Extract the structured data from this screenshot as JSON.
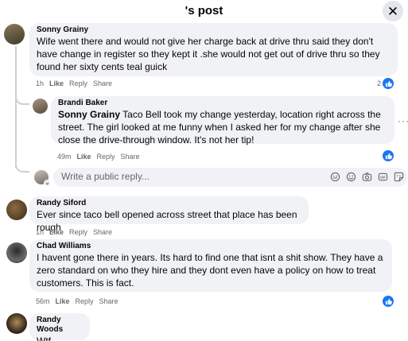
{
  "header": {
    "title": "'s post",
    "close_label": "✕"
  },
  "comments": [
    {
      "name": "Sonny Grainy",
      "text": "Wife went there and would not give her charge back at drive thru said they don't have change in register so they kept it .she would not get out of drive thru so they found her sixty cents teal guick",
      "time": "1h",
      "like": "Like",
      "reply": "Reply",
      "share": "Share",
      "reaction_count": "2"
    },
    {
      "name": "Brandi Baker",
      "mention": "Sonny Grainy",
      "text": " Taco Bell took my change yesterday, location right across the street. The girl looked at me funny when I asked her for my change after she close the drive-through window. It's not her tip!",
      "time": "49m",
      "like": "Like",
      "reply": "Reply",
      "share": "Share"
    },
    {
      "name": "Randy Siford",
      "text": "Ever since taco bell opened across street that place has been rough",
      "time": "1h",
      "like": "Like",
      "reply": "Reply",
      "share": "Share"
    },
    {
      "name": "Chad Williams",
      "text": "I havent gone there in years. Its hard to find one that isnt a shit show. They have a zero standard on who they hire and they dont even have a policy on how to treat customers. This is fact.",
      "time": "56m",
      "like": "Like",
      "reply": "Reply",
      "share": "Share"
    },
    {
      "name": "Randy Woods",
      "text": "Wtf..."
    }
  ],
  "reply_box": {
    "placeholder": "Write a public reply..."
  },
  "more_label": "···",
  "colors": {
    "accent": "#1877f2",
    "bubble": "#f0f2f5",
    "muted": "#65676b"
  }
}
